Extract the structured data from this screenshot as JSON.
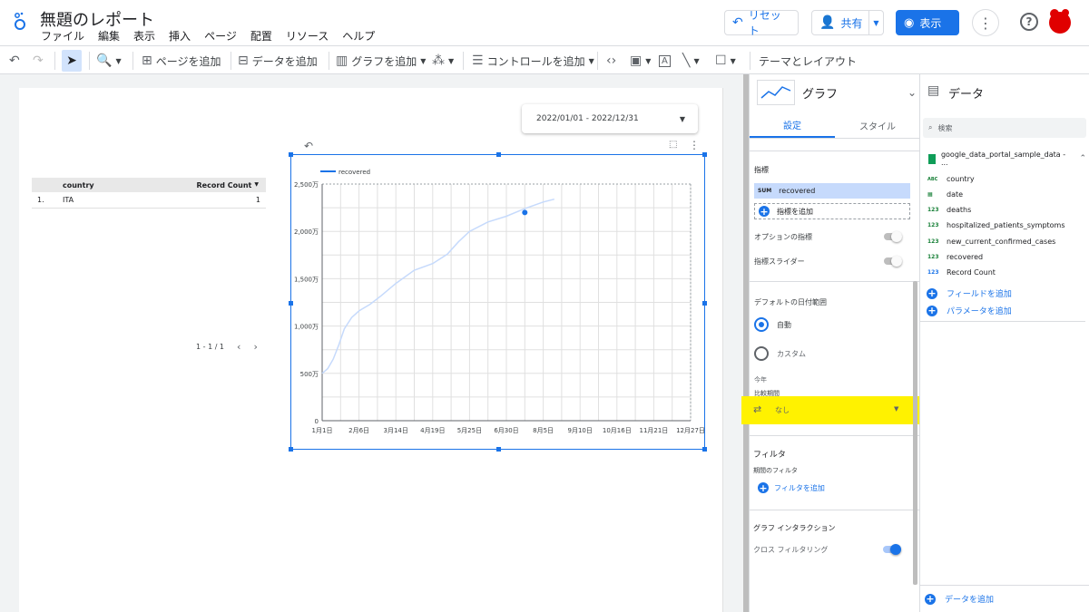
{
  "header": {
    "title": "無題のレポート",
    "menus": [
      "ファイル",
      "編集",
      "表示",
      "挿入",
      "ページ",
      "配置",
      "リソース",
      "ヘルプ"
    ],
    "reset_label": "リセット",
    "share_label": "共有",
    "view_label": "表示"
  },
  "toolbar": {
    "add_page": "ページを追加",
    "add_data": "データを追加",
    "add_chart": "グラフを追加",
    "add_control": "コントロールを追加",
    "theme_layout": "テーマとレイアウト"
  },
  "date_control": {
    "value": "2022/01/01 - 2022/12/31"
  },
  "table": {
    "columns": [
      "country",
      "Record Count"
    ],
    "rows": [
      {
        "index": "1.",
        "country": "ITA",
        "count": "1"
      }
    ],
    "pager": "1 - 1 / 1"
  },
  "chart_data": {
    "type": "line",
    "series": [
      {
        "name": "recovered",
        "color": "#c6dafc"
      }
    ],
    "x_ticks": [
      "1月1日",
      "2月6日",
      "3月14日",
      "4月19日",
      "5月25日",
      "6月30日",
      "8月5日",
      "9月10日",
      "10月16日",
      "11月21日",
      "12月27日"
    ],
    "y_ticks": [
      "0",
      "500万",
      "1,000万",
      "1,500万",
      "2,000万",
      "2,500万"
    ],
    "ylim": [
      0,
      25000000
    ],
    "points": [
      [
        0,
        5000000
      ],
      [
        0.15,
        5500000
      ],
      [
        0.3,
        6500000
      ],
      [
        0.45,
        8000000
      ],
      [
        0.6,
        9700000
      ],
      [
        0.8,
        10900000
      ],
      [
        1.0,
        11600000
      ],
      [
        1.3,
        12300000
      ],
      [
        1.6,
        13200000
      ],
      [
        2.0,
        14500000
      ],
      [
        2.5,
        15900000
      ],
      [
        3.0,
        16600000
      ],
      [
        3.4,
        17600000
      ],
      [
        3.7,
        18900000
      ],
      [
        4.0,
        20000000
      ],
      [
        4.5,
        21000000
      ],
      [
        5.0,
        21600000
      ],
      [
        5.5,
        22400000
      ],
      [
        6.0,
        23100000
      ],
      [
        6.3,
        23400000
      ]
    ],
    "marker_point": [
      5.5,
      22000000
    ],
    "grid": true,
    "legend": "top-left"
  },
  "panel_chart": {
    "type_label": "グラフ",
    "tab_setup": "設定",
    "tab_style": "スタイル",
    "metric_label": "指標",
    "metric_agg": "SUM",
    "metric_name": "recovered",
    "add_metric": "指標を追加",
    "optional_metrics": "オプションの指標",
    "metric_slider": "指標スライダー",
    "default_date_range": "デフォルトの日付範囲",
    "auto": "自動",
    "custom": "カスタム",
    "this_year": "今年",
    "comparison_period": "比較期間",
    "none": "なし",
    "filter": "フィルタ",
    "period_filter": "期間のフィルタ",
    "add_filter": "フィルタを追加",
    "interaction": "グラフ インタラクション",
    "cross_filter": "クロス フィルタリング"
  },
  "panel_data": {
    "title": "データ",
    "search_placeholder": "検索",
    "source": "google_data_portal_sample_data - ...",
    "fields": [
      {
        "type": "ABC",
        "name": "country"
      },
      {
        "type": "date",
        "name": "date"
      },
      {
        "type": "123",
        "name": "deaths"
      },
      {
        "type": "123",
        "name": "hospitalized_patients_symptoms"
      },
      {
        "type": "123",
        "name": "new_current_confirmed_cases"
      },
      {
        "type": "123",
        "name": "recovered"
      },
      {
        "type": "123",
        "name": "Record Count"
      }
    ],
    "add_field": "フィールドを追加",
    "add_param": "パラメータを追加",
    "add_data": "データを追加"
  }
}
